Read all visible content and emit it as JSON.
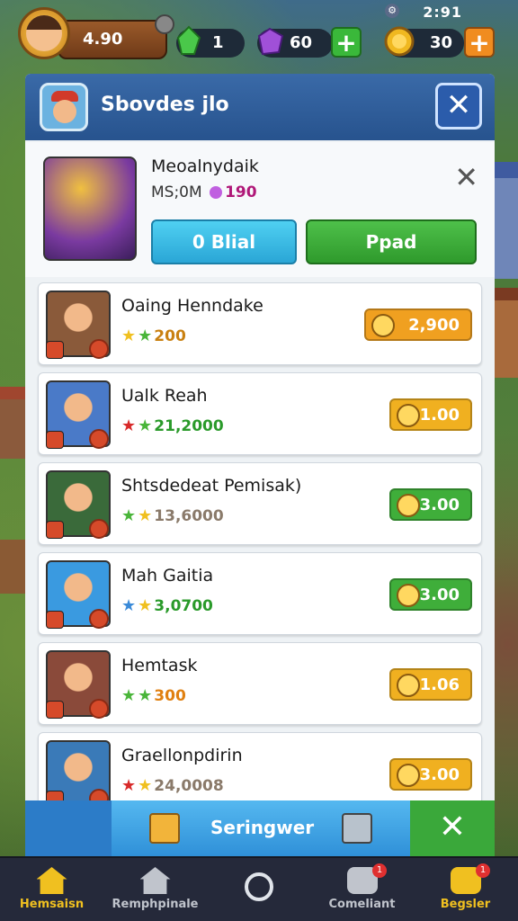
{
  "topbar": {
    "clock": "2:91",
    "coins": "4.90",
    "gems_green": "1",
    "gems_purple": "60",
    "gold": "30"
  },
  "panel": {
    "title": "Sbovdes jlo",
    "featured": {
      "name": "Meoalnydaik",
      "sub_prefix": "MS;0M",
      "sub_value": "190",
      "btn_secondary": "0 Blial",
      "btn_primary": "Ppad"
    }
  },
  "items": [
    {
      "name": "Oaing Henndake",
      "sub": "200",
      "price": "2,900",
      "price_color": "#f0a020",
      "sub_color": "#c98010",
      "stars": [
        "#f0c020",
        "#4ab53a"
      ],
      "img": "#8a5a3a"
    },
    {
      "name": "Ualk Reah",
      "sub": "21,2000",
      "price": "1.00",
      "price_color": "#f0b020",
      "sub_color": "#2a9a2a",
      "stars": [
        "#d82a2a",
        "#4ab53a"
      ],
      "img": "#4a7ac8"
    },
    {
      "name": "Shtsdedeat Pemisak)",
      "sub": "13,6000",
      "price": "3.00",
      "price_color": "#3fae3a",
      "sub_color": "#8a7a6a",
      "stars": [
        "#4ab53a",
        "#f0c020"
      ],
      "img": "#3a6a3a"
    },
    {
      "name": "Mah Gaitia",
      "sub": "3,0700",
      "price": "3.00",
      "price_color": "#3fae3a",
      "sub_color": "#2a9a2a",
      "stars": [
        "#3a8ad8",
        "#f0c020"
      ],
      "img": "#3a9ae0"
    },
    {
      "name": "Hemtask",
      "sub": "300",
      "price": "1.06",
      "price_color": "#f0b020",
      "sub_color": "#e08010",
      "stars": [
        "#4ab53a",
        "#4ab53a"
      ],
      "img": "#8a4a3a"
    },
    {
      "name": "Graellonpdirin",
      "sub": "24,0008",
      "price": "3.00",
      "price_color": "#f0b020",
      "sub_color": "#8a7a6a",
      "stars": [
        "#d82a2a",
        "#f0c020"
      ],
      "img": "#3a7ab8"
    }
  ],
  "footer_panel": {
    "label": "Seringwer"
  },
  "navbar": {
    "items": [
      {
        "label": "Hemsaisn",
        "color": "#f0c020"
      },
      {
        "label": "Remphpinale",
        "color": "#c0c4cc"
      },
      {
        "label": "",
        "color": "#e0e4ea"
      },
      {
        "label": "Comeliant",
        "color": "#c0c4cc",
        "badge": "1"
      },
      {
        "label": "Begsler",
        "color": "#f0c020",
        "badge": "1"
      }
    ]
  }
}
